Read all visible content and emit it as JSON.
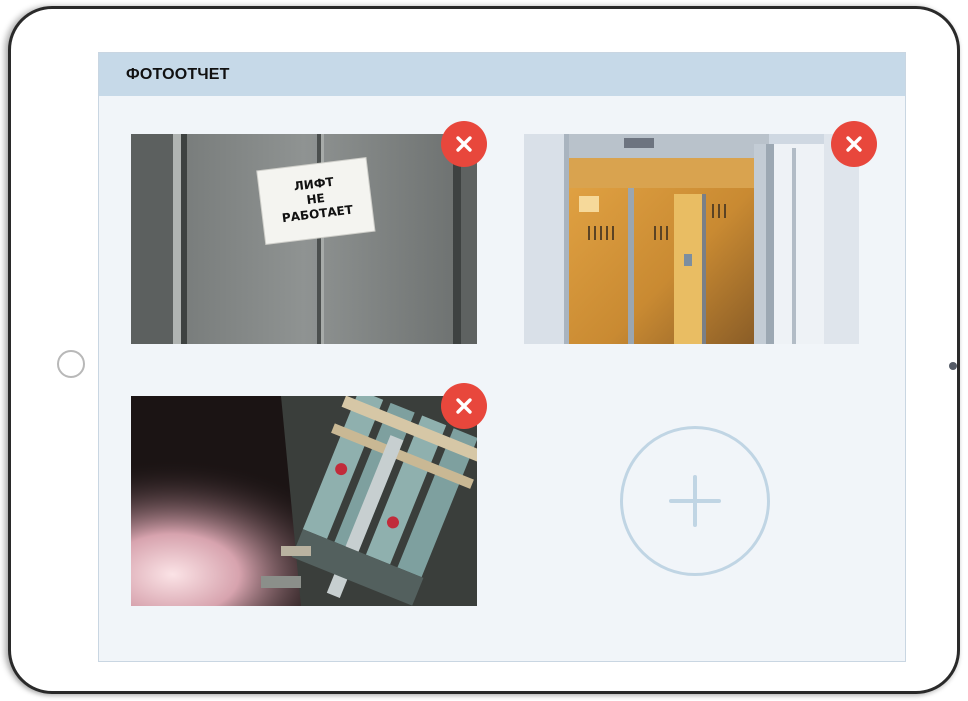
{
  "panel": {
    "title": "ФОТООТЧЕТ"
  },
  "photos": [
    {
      "subject": "elevator-door-sign",
      "sign_text": [
        "ЛИФТ",
        "НЕ",
        "РАБОТАЕТ"
      ],
      "delete_icon": "close-icon"
    },
    {
      "subject": "open-elevator-cabin",
      "delete_icon": "close-icon"
    },
    {
      "subject": "elevator-control-relays",
      "delete_icon": "close-icon"
    }
  ],
  "add_photo": {
    "icon": "plus-icon"
  },
  "colors": {
    "header_bg": "#c6d9e8",
    "panel_bg": "#f1f5f9",
    "delete_red": "#e8473c",
    "add_outline": "#c0d5e4"
  }
}
